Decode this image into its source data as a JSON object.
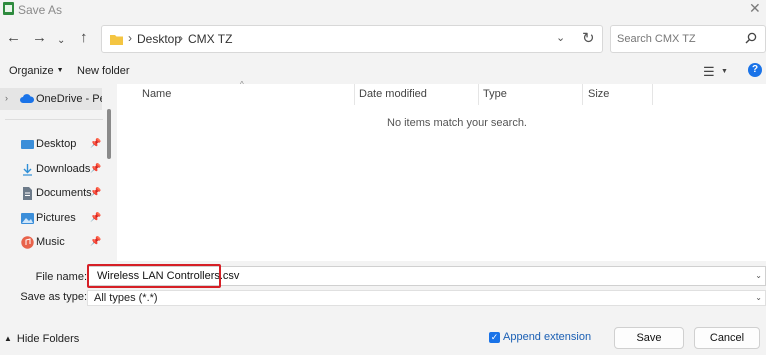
{
  "window": {
    "title": "Save As"
  },
  "address_bar": {
    "crumbs": [
      "Desktop",
      "CMX TZ"
    ]
  },
  "search": {
    "placeholder": "Search CMX TZ"
  },
  "toolbar": {
    "organize_label": "Organize",
    "new_folder_label": "New folder"
  },
  "sidebar": {
    "onedrive_label": "OneDrive - Personal",
    "items": [
      {
        "label": "Desktop",
        "icon": "desktop-icon",
        "color": "#3b8ed9"
      },
      {
        "label": "Downloads",
        "icon": "download-icon",
        "color": "#2f8fd6"
      },
      {
        "label": "Documents",
        "icon": "document-icon",
        "color": "#6c7a89"
      },
      {
        "label": "Pictures",
        "icon": "pictures-icon",
        "color": "#3b8ed9"
      },
      {
        "label": "Music",
        "icon": "music-icon",
        "color": "#e8624a"
      }
    ]
  },
  "file_list": {
    "columns": [
      "Name",
      "Date modified",
      "Type",
      "Size"
    ],
    "empty_message": "No items match your search."
  },
  "form": {
    "file_name_label": "File name:",
    "file_name_value": "Wireless LAN Controllers.csv",
    "save_as_type_label": "Save as type:",
    "save_as_type_value": "All types (*.*)"
  },
  "footer": {
    "hide_folders_label": "Hide Folders",
    "append_extension_label": "Append extension",
    "append_extension_checked": true,
    "save_label": "Save",
    "cancel_label": "Cancel"
  },
  "colors": {
    "accent": "#1a73e8",
    "highlight_border": "#d61f26"
  }
}
